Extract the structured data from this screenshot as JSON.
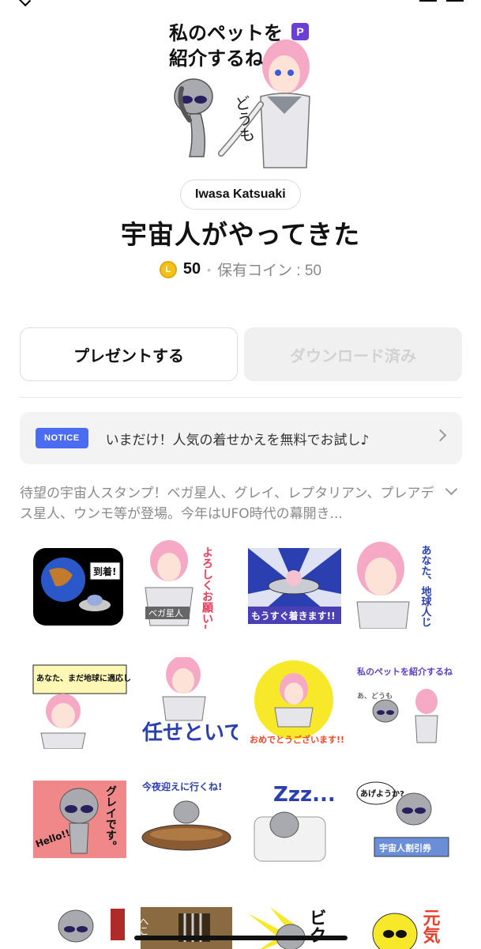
{
  "sticker_set": {
    "title": "宇宙人がやってきた",
    "author": "Iwasa Katsuaki",
    "premium_badge": "P",
    "main_image": {
      "caption_top": "私のペットを",
      "caption_bottom": "紹介するね",
      "side_text": "どうも"
    }
  },
  "price": {
    "coin_symbol": "L",
    "amount": "50",
    "separator": "•",
    "owned_text": "保有コイン : 50"
  },
  "actions": {
    "gift_label": "プレゼントする",
    "download_label": "ダウンロード済み"
  },
  "notice": {
    "tag": "NOTICE",
    "text": "いまだけ！人気の着せかえを無料でお試し♪"
  },
  "description": "待望の宇宙人スタンプ！ベガ星人、グレイ、レプタリアン、プレアデス星人、ウンモ等が登場。今年はUFO時代の幕開き...",
  "stickers": [
    {
      "label": "到着!"
    },
    {
      "label": "よろしくお願いします",
      "tag": "ベガ星人"
    },
    {
      "label": "もうすぐ着きます!!"
    },
    {
      "label": "あなた、地球人じゃないわね"
    },
    {
      "label": "あなた、まだ地球に適応してないわね…"
    },
    {
      "label": "任せといて"
    },
    {
      "label": "おめでとうございます!!"
    },
    {
      "label": "私のペットを紹介するね",
      "tag": "あ、どうも"
    },
    {
      "label": "グレイです。",
      "tag": "Hello!!"
    },
    {
      "label": "今夜迎えに行くね!"
    },
    {
      "label": "Zzz..."
    },
    {
      "label": "あげようか?",
      "tag": "宇宙人割引券"
    },
    {
      "label": ""
    },
    {
      "label": "へこ"
    },
    {
      "label": "ビク"
    },
    {
      "label": "元気"
    }
  ],
  "colors": {
    "accent": "#4b6cf0",
    "coin": "#f2c21a",
    "premium": "#6a3fd8"
  }
}
